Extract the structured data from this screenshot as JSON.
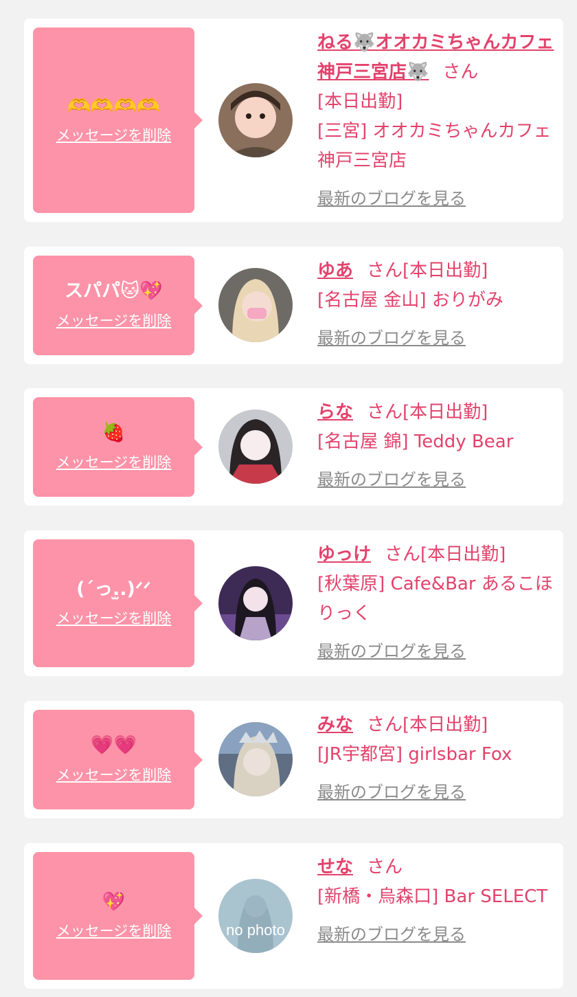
{
  "delete_label": "メッセージを削除",
  "blog_label": "最新のブログを見る",
  "suffix_san": "さん",
  "colors": {
    "accent": "#e2426b",
    "bubble": "#fd93a8",
    "muted": "#8a8a8a"
  },
  "items": [
    {
      "message": "🫶🫶🫶🫶",
      "name": "ねる🐺オオカミちゃんカフェ神戸三宮店🐺",
      "status": "[本日出勤]",
      "shop": "[三宮] オオカミちゃんカフェ神戸三宮店",
      "avatar": "avatar-photo"
    },
    {
      "message": "スパパ🐱💖",
      "name": "ゆあ",
      "status": "[本日出勤]",
      "shop": "[名古屋 金山] おりがみ",
      "avatar": "avatar-photo"
    },
    {
      "message": "🍓",
      "name": "らな",
      "status": "[本日出勤]",
      "shop": "[名古屋 錦] Teddy Bear",
      "avatar": "avatar-photo"
    },
    {
      "message": "(ˊっ.̫.)ᐟᐟ",
      "name": "ゆっけ",
      "status": "[本日出勤]",
      "shop": "[秋葉原] Cafe&Bar あるこほりっく",
      "avatar": "avatar-photo"
    },
    {
      "message": "💗💗",
      "name": "みな",
      "status": "[本日出勤]",
      "shop": "[JR宇都宮] girlsbar Fox",
      "avatar": "avatar-photo"
    },
    {
      "message": "💖",
      "name": "せな",
      "status": "",
      "shop": "[新橋・烏森口] Bar SELECT",
      "avatar": "no-photo",
      "avatar_text": "no photo"
    }
  ]
}
